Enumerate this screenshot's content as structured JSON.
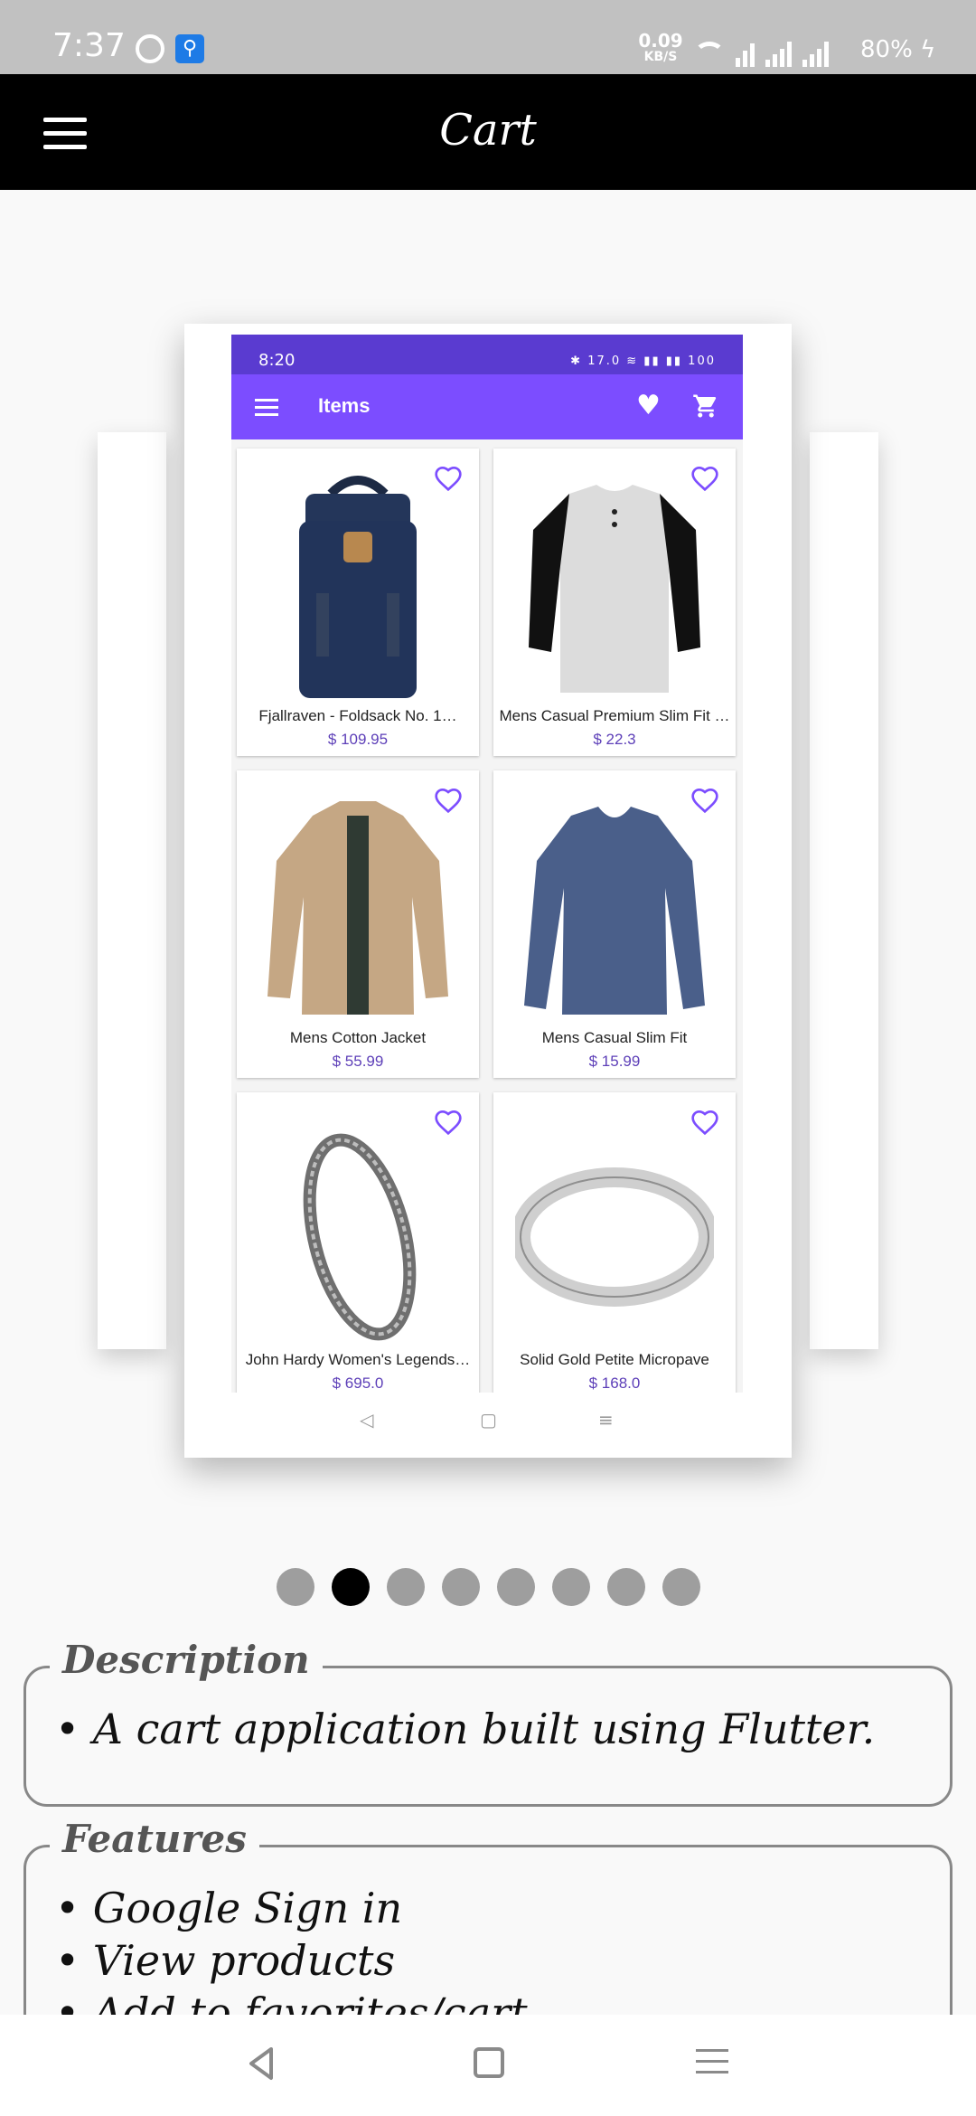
{
  "status_bar": {
    "time": "7:37",
    "net_speed_value": "0.09",
    "net_speed_unit": "KB/S",
    "battery": "80%"
  },
  "app_bar": {
    "title": "Cart"
  },
  "screenshot": {
    "status_time": "8:20",
    "status_icons": "✱ 17.0 ≋ ▮▮ ▮▮ 100",
    "app_title": "Items",
    "products": [
      {
        "name": "Fjallraven - Foldsack No. 1…",
        "price": "$ 109.95"
      },
      {
        "name": "Mens Casual Premium Slim Fit …",
        "price": "$ 22.3"
      },
      {
        "name": "Mens Cotton Jacket",
        "price": "$ 55.99"
      },
      {
        "name": "Mens Casual Slim Fit",
        "price": "$ 15.99"
      },
      {
        "name": "John Hardy Women's Legends…",
        "price": "$ 695.0"
      },
      {
        "name": "Solid Gold Petite Micropave",
        "price": "$ 168.0"
      }
    ],
    "accent": "#7c4dff"
  },
  "carousel": {
    "dot_count": 8,
    "active_index": 1
  },
  "description": {
    "legend": "Description",
    "lines": [
      "• A cart application built using Flutter."
    ]
  },
  "features": {
    "legend": "Features",
    "lines": [
      "• Google Sign in",
      "• View products",
      "• Add to favorites/cart"
    ]
  }
}
